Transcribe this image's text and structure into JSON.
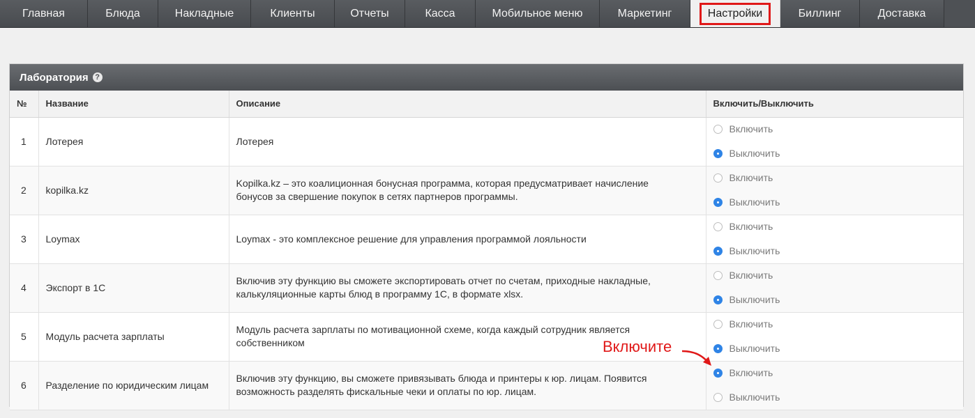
{
  "nav": {
    "tabs": [
      {
        "label": "Главная",
        "name": "tab-main"
      },
      {
        "label": "Блюда",
        "name": "tab-dishes"
      },
      {
        "label": "Накладные",
        "name": "tab-invoices"
      },
      {
        "label": "Клиенты",
        "name": "tab-clients"
      },
      {
        "label": "Отчеты",
        "name": "tab-reports"
      },
      {
        "label": "Касса",
        "name": "tab-cashbox"
      },
      {
        "label": "Мобильное меню",
        "name": "tab-mobile-menu"
      },
      {
        "label": "Маркетинг",
        "name": "tab-marketing"
      },
      {
        "label": "Настройки",
        "name": "tab-settings"
      },
      {
        "label": "Биллинг",
        "name": "tab-billing"
      },
      {
        "label": "Доставка",
        "name": "tab-delivery"
      }
    ],
    "active_index": 8
  },
  "panel": {
    "title": "Лаборатория",
    "help_icon": "?",
    "columns": [
      "№",
      "Название",
      "Описание",
      "Включить/Выключить"
    ],
    "enable_label": "Включить",
    "disable_label": "Выключить",
    "rows": [
      {
        "num": "1",
        "name": "Лотерея",
        "desc": "Лотерея",
        "enabled": false
      },
      {
        "num": "2",
        "name": "kopilka.kz",
        "desc": "Kopilka.kz – это коалиционная бонусная программа, которая предусматривает начисление бонусов за свершение покупок в сетях партнеров программы.",
        "enabled": false
      },
      {
        "num": "3",
        "name": "Loymax",
        "desc": "Loymax - это комплексное решение для управления программой лояльности",
        "enabled": false
      },
      {
        "num": "4",
        "name": "Экспорт в 1С",
        "desc": "Включив эту функцию вы сможете экспортировать отчет по счетам, приходные накладные, калькуляционные карты блюд в программу 1С, в формате xlsx.",
        "enabled": false
      },
      {
        "num": "5",
        "name": "Модуль расчета зарплаты",
        "desc": "Модуль расчета зарплаты по мотивационной схеме, когда каждый сотрудник является собственником",
        "enabled": false
      },
      {
        "num": "6",
        "name": "Разделение по юридическим лицам",
        "desc": "Включив эту функцию, вы сможете привязывать блюда и принтеры к юр. лицам. Появится возможность разделять фискальные чеки и оплаты по юр. лицам.",
        "enabled": true
      }
    ]
  },
  "annotation": {
    "text": "Включите",
    "color": "#e01818"
  },
  "colors": {
    "accent": "#2f84e6",
    "highlight": "#e01818",
    "nav_bg": "#4e5155"
  }
}
